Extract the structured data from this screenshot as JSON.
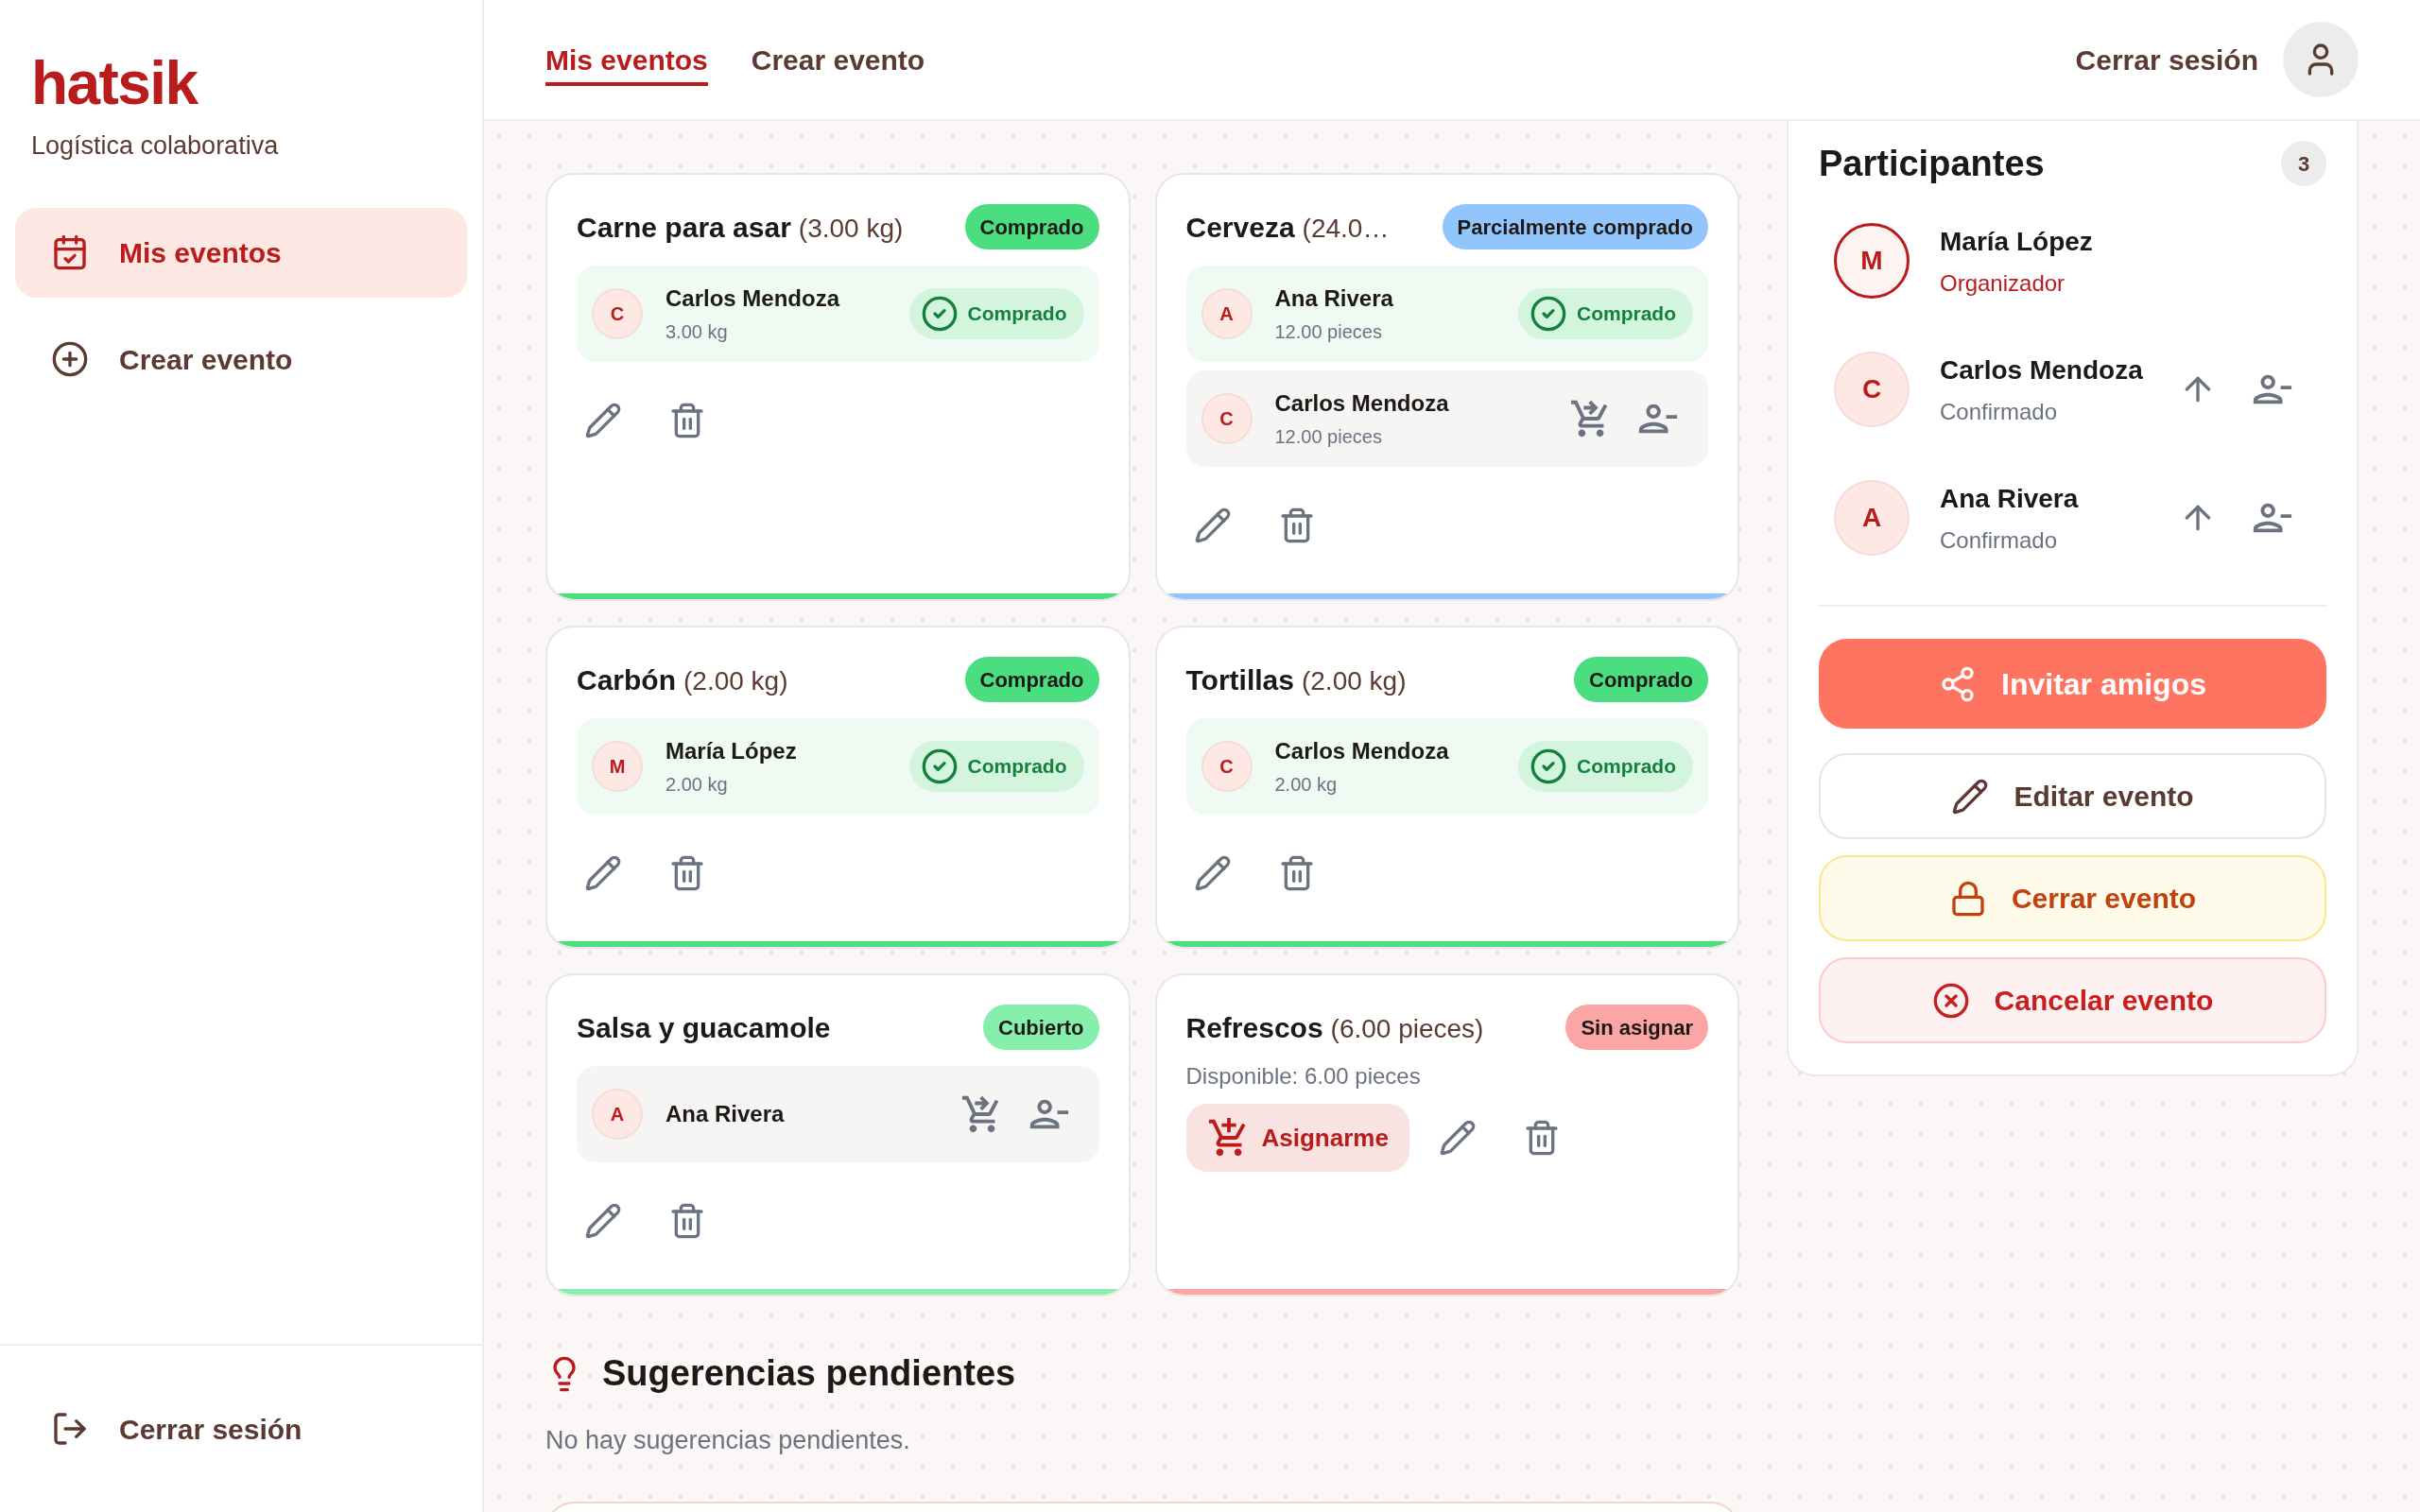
{
  "sidebar": {
    "logo": "hatsik",
    "tagline": "Logística colaborativa",
    "items": [
      {
        "kind": "events",
        "label": "Mis eventos",
        "selected": true
      },
      {
        "kind": "create",
        "label": "Crear evento",
        "selected": false
      }
    ],
    "logout": "Cerrar sesión"
  },
  "header": {
    "tabs": [
      {
        "label": "Mis eventos",
        "selected": true
      },
      {
        "label": "Crear evento",
        "selected": false
      }
    ],
    "logout": "Cerrar sesión"
  },
  "items": [
    {
      "title": "Carne para asar",
      "quantity": "(3.00 kg)",
      "status": {
        "label": "Comprado",
        "color": "#4ade80"
      },
      "assignments": [
        {
          "initial": "C",
          "name": "Carlos Mendoza",
          "quantity": "3.00 kg",
          "bought": true,
          "badge": "Comprado"
        }
      ]
    },
    {
      "title": "Cerveza",
      "quantity": "(24.0…",
      "status": {
        "label": "Parcialmente comprado",
        "color": "#93c5fd"
      },
      "assignments": [
        {
          "initial": "A",
          "name": "Ana Rivera",
          "quantity": "12.00 pieces",
          "bought": true,
          "badge": "Comprado"
        },
        {
          "initial": "C",
          "name": "Carlos Mendoza",
          "quantity": "12.00 pieces",
          "bought": false
        }
      ]
    },
    {
      "title": "Carbón",
      "quantity": "(2.00 kg)",
      "status": {
        "label": "Comprado",
        "color": "#4ade80"
      },
      "assignments": [
        {
          "initial": "M",
          "name": "María López",
          "quantity": "2.00 kg",
          "bought": true,
          "badge": "Comprado"
        }
      ]
    },
    {
      "title": "Tortillas",
      "quantity": "(2.00 kg)",
      "status": {
        "label": "Comprado",
        "color": "#4ade80"
      },
      "assignments": [
        {
          "initial": "C",
          "name": "Carlos Mendoza",
          "quantity": "2.00 kg",
          "bought": true,
          "badge": "Comprado"
        }
      ]
    },
    {
      "title": "Salsa y guacamole",
      "status": {
        "label": "Cubierto",
        "color": "#86efac"
      },
      "assignments": [
        {
          "initial": "A",
          "name": "Ana Rivera",
          "bought": false
        }
      ]
    },
    {
      "title": "Refrescos",
      "quantity": "(6.00 pieces)",
      "status": {
        "label": "Sin asignar",
        "color": "#fca5a5"
      },
      "available": "Disponible: 6.00 pieces",
      "assign_button": "Asignarme"
    }
  ],
  "participants": {
    "title": "Participantes",
    "count": "3",
    "list": [
      {
        "initial": "M",
        "name": "María López",
        "role": "Organizador",
        "organizer": true
      },
      {
        "initial": "C",
        "name": "Carlos Mendoza",
        "role": "Confirmado",
        "organizer": false
      },
      {
        "initial": "A",
        "name": "Ana Rivera",
        "role": "Confirmado",
        "organizer": false
      }
    ]
  },
  "actions": [
    {
      "kind": "invite",
      "label": "Invitar amigos"
    },
    {
      "kind": "edit",
      "label": "Editar evento"
    },
    {
      "kind": "close",
      "label": "Cerrar evento"
    },
    {
      "kind": "cancel",
      "label": "Cancelar evento"
    }
  ],
  "suggestions": {
    "title": "Sugerencias pendientes",
    "empty": "No hay sugerencias pendientes."
  }
}
